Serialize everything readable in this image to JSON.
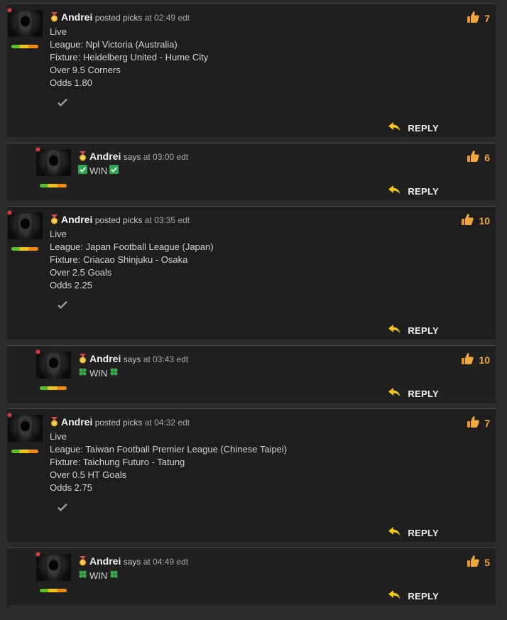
{
  "posts": [
    {
      "type": "main",
      "user": "Andrei",
      "action": "posted picks",
      "time": "at 02:49 edt",
      "lines": [
        "Live",
        "League: Npl Victoria (Australia)",
        "Fixture: Heidelberg United - Hume City",
        "Over 9.5 Corners",
        "Odds 1.80"
      ],
      "likes": "7",
      "reply_label": "REPLY"
    },
    {
      "type": "reply",
      "user": "Andrei",
      "action": "says",
      "time": "at 03:00 edt",
      "result_text": "WIN",
      "result_emoji": "check",
      "likes": "6",
      "reply_label": "REPLY"
    },
    {
      "type": "main",
      "user": "Andrei",
      "action": "posted picks",
      "time": "at 03:35 edt",
      "lines": [
        "Live",
        "League: Japan Football League (Japan)",
        "Fixture: Criacao Shinjuku - Osaka",
        "Over 2.5 Goals",
        "Odds 2.25"
      ],
      "likes": "10",
      "reply_label": "REPLY"
    },
    {
      "type": "reply",
      "user": "Andrei",
      "action": "says",
      "time": "at 03:43 edt",
      "result_text": "WIN",
      "result_emoji": "clover",
      "likes": "10",
      "reply_label": "REPLY"
    },
    {
      "type": "main",
      "user": "Andrei",
      "action": "posted picks",
      "time": "at 04:32 edt",
      "lines": [
        "Live",
        "League: Taiwan Football Premier League (Chinese Taipei)",
        "Fixture: Taichung Futuro - Tatung",
        "Over 0.5 HT Goals",
        "Odds 2.75"
      ],
      "likes": "7",
      "reply_label": "REPLY"
    },
    {
      "type": "reply",
      "user": "Andrei",
      "action": "says",
      "time": "at 04:49 edt",
      "result_text": "WIN",
      "result_emoji": "clover",
      "likes": "5",
      "reply_label": "REPLY"
    }
  ],
  "colors": {
    "background": "#2b2b2b",
    "card": "#1e1e1e",
    "like_count": "#f0a83a",
    "reply_arrow": "#f5c518"
  }
}
